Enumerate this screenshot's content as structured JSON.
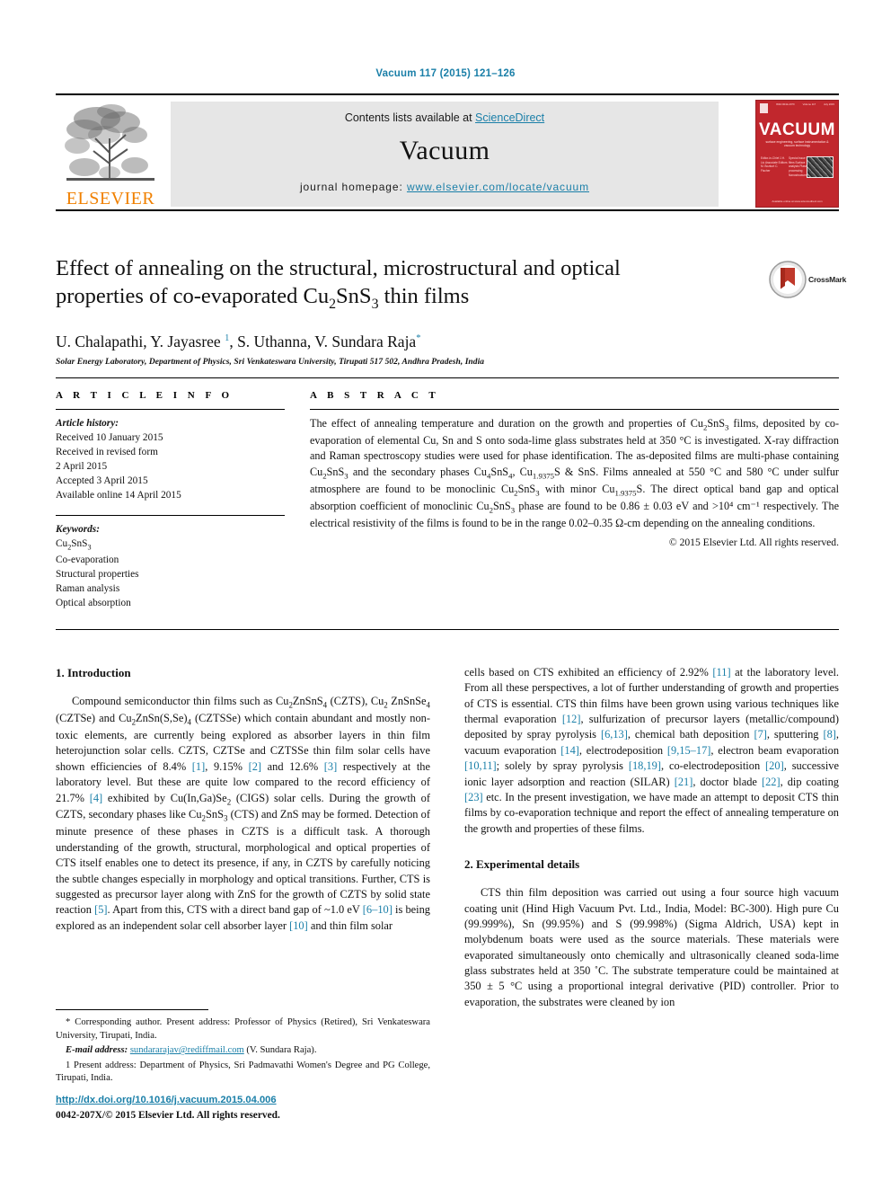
{
  "running_head": "Vacuum 117 (2015) 121–126",
  "masthead": {
    "publisher": "ELSEVIER",
    "contents_prefix": "Contents lists available at ",
    "contents_link": "ScienceDirect",
    "journal_name": "Vacuum",
    "homepage_prefix": "journal homepage: ",
    "homepage_url": "www.elsevier.com/locate/vacuum",
    "cover": {
      "title": "VACUUM",
      "subtitle": "surface engineering, surface instrumentation & vacuum technology",
      "top_left": "ISSN 0042-207X",
      "top_mid": "Volume 117",
      "top_right": "July 2015",
      "left_text": "Editor-in-Chief\nJ.H. Liu\nAssociate Editors\nM. Bozkurt\nC. Fischer",
      "mid_text": "Special issue\nThin films\nSurface analysis\nPlasma processing\nNanostructures",
      "bottom_text": "Available online at www.sciencedirect.com"
    }
  },
  "article": {
    "title_line1": "Effect of annealing on the structural, microstructural and optical",
    "title_line2_a": "properties of co-evaporated Cu",
    "title_sub1": "2",
    "title_line2_b": "SnS",
    "title_sub2": "3",
    "title_line2_c": " thin films",
    "crossmark_label": "CrossMark",
    "authors": "U. Chalapathi, Y. Jayasree ",
    "authors_sup1": "1",
    "authors_b": ", S. Uthanna, V. Sundara Raja",
    "authors_star": "*",
    "affiliation": "Solar Energy Laboratory, Department of Physics, Sri Venkateswara University, Tirupati 517 502, Andhra Pradesh, India"
  },
  "article_info": {
    "heading": "A R T I C L E   I N F O",
    "history_label": "Article history:",
    "history": [
      "Received 10 January 2015",
      "Received in revised form",
      "2 April 2015",
      "Accepted 3 April 2015",
      "Available online 14 April 2015"
    ],
    "keywords_label": "Keywords:",
    "keywords": [
      "Cu2SnS3",
      "Co-evaporation",
      "Structural properties",
      "Raman analysis",
      "Optical absorption"
    ]
  },
  "abstract": {
    "heading": "A B S T R A C T",
    "text": "The effect of annealing temperature and duration on the growth and properties of Cu2SnS3 films, deposited by co-evaporation of elemental Cu, Sn and S onto soda-lime glass substrates held at 350 °C is investigated. X-ray diffraction and Raman spectroscopy studies were used for phase identification. The as-deposited films are multi-phase containing Cu2SnS3 and the secondary phases Cu4SnS4, Cu1.9375S & SnS. Films annealed at 550 °C and 580 °C under sulfur atmosphere are found to be monoclinic Cu2SnS3 with minor Cu1.9375S. The direct optical band gap and optical absorption coefficient of monoclinic Cu2SnS3 phase are found to be 0.86 ± 0.03 eV and >10⁴ cm⁻¹ respectively. The electrical resistivity of the films is found to be in the range 0.02–0.35 Ω-cm depending on the annealing conditions.",
    "copyright": "© 2015 Elsevier Ltd. All rights reserved."
  },
  "sections": {
    "intro_heading": "1.  Introduction",
    "intro_p1": "Compound semiconductor thin films such as Cu2ZnSnS4 (CZTS), Cu2 ZnSnSe4 (CZTSe) and Cu2ZnSn(S,Se)4 (CZTSSe) which contain abundant and mostly non-toxic elements, are currently being explored as absorber layers in thin film heterojunction solar cells. CZTS, CZTSe and CZTSSe thin film solar cells have shown efficiencies of 8.4% [1], 9.15% [2] and 12.6% [3] respectively at the laboratory level. But these are quite low compared to the record efficiency of 21.7% [4] exhibited by Cu(In,Ga)Se2 (CIGS) solar cells. During the growth of CZTS, secondary phases like Cu2SnS3 (CTS) and ZnS may be formed. Detection of minute presence of these phases in CZTS is a difficult task. A thorough understanding of the growth, structural, morphological and optical properties of CTS itself enables one to detect its presence, if any, in CZTS by carefully noticing the subtle changes especially in morphology and optical transitions. Further, CTS is suggested as precursor layer along with ZnS for the growth of CZTS by solid state reaction [5]. Apart from this, CTS with a direct band gap of ~1.0 eV [6–10] is being explored as an independent solar cell absorber layer [10] and thin film solar cells based on CTS exhibited an efficiency of 2.92% [11] at the laboratory level. From all these perspectives, a lot of further understanding of growth and properties of CTS is essential. CTS thin films have been grown using various techniques like thermal evaporation [12], sulfurization of precursor layers (metallic/compound) deposited by spray pyrolysis [6,13], chemical bath deposition [7], sputtering [8], vacuum evaporation [14], electrodeposition [9,15–17], electron beam evaporation [10,11]; solely by spray pyrolysis [18,19], co-electrodeposition [20], successive ionic layer adsorption and reaction (SILAR) [21], doctor blade [22], dip coating [23] etc. In the present investigation, we have made an attempt to deposit CTS thin films by co-evaporation technique and report the effect of annealing temperature on the growth and properties of these films.",
    "exp_heading": "2.  Experimental details",
    "exp_p1": "CTS thin film deposition was carried out using a four source high vacuum coating unit (Hind High Vacuum Pvt. Ltd., India, Model: BC-300). High pure Cu (99.999%), Sn (99.95%) and S (99.998%) (Sigma Aldrich, USA) kept in molybdenum boats were used as the source materials. These materials were evaporated simultaneously onto chemically and ultrasonically cleaned soda-lime glass substrates held at 350 ˚C. The substrate temperature could be maintained at 350 ± 5 °C using a proportional integral derivative (PID) controller. Prior to evaporation, the substrates were cleaned by ion"
  },
  "footnotes": {
    "corresponding": "* Corresponding author. Present address: Professor of Physics (Retired), Sri Venkateswara University, Tirupati, India.",
    "email_label": "E-mail address:",
    "email": "sundararajav@rediffmail.com",
    "email_person": "(V. Sundara Raja).",
    "present_address": "1  Present address: Department of Physics, Sri Padmavathi Women's Degree and PG College, Tirupati, India."
  },
  "footer": {
    "doi": "http://dx.doi.org/10.1016/j.vacuum.2015.04.006",
    "issn": "0042-207X/© 2015 Elsevier Ltd. All rights reserved."
  },
  "colors": {
    "link": "#1a7fa8",
    "cover_red": "#c1272d",
    "elsevier_orange": "#f08000",
    "panel_grey": "#e6e6e6"
  }
}
